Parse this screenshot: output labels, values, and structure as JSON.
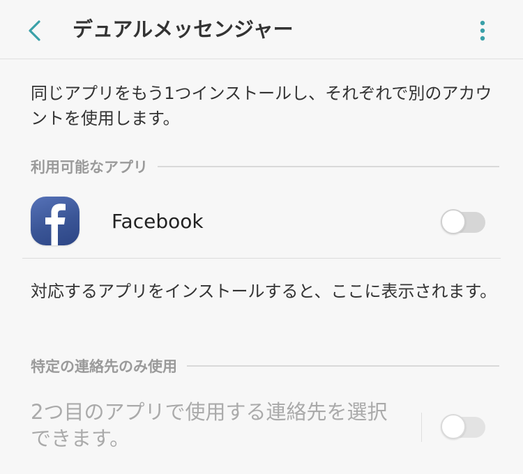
{
  "header": {
    "title": "デュアルメッセンジャー",
    "back_icon": "chevron-left-icon",
    "more_icon": "more-vertical-icon",
    "accent_color": "#3aa0a8"
  },
  "intro": {
    "text": "同じアプリをもう1つインストールし、それぞれで別のアカウントを使用します。"
  },
  "available_apps": {
    "section_label": "利用可能なアプリ",
    "apps": [
      {
        "name": "Facebook",
        "icon": "facebook-icon",
        "enabled": false
      }
    ]
  },
  "supported_note": {
    "text": "対応するアプリをインストールすると、ここに表示されます。"
  },
  "specific_contacts": {
    "section_label": "特定の連絡先のみ使用",
    "option_text": "2つ目のアプリで使用する連絡先を選択できます。",
    "enabled": false,
    "disabled": true
  }
}
